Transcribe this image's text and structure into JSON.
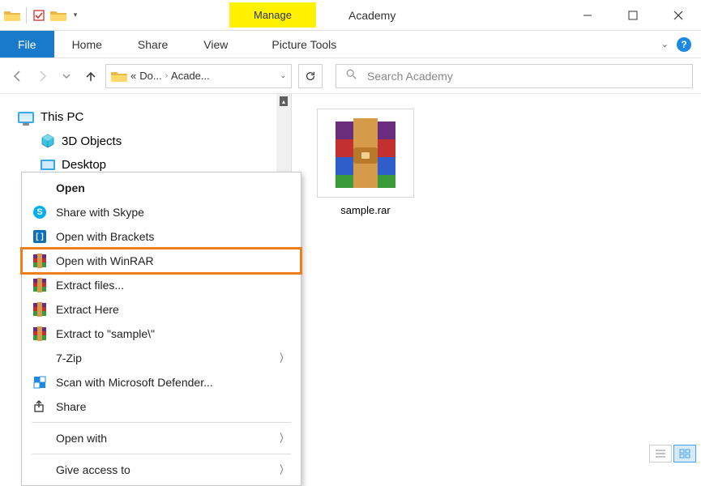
{
  "window": {
    "title": "Academy",
    "contextual_tab": "Manage",
    "contextual_group": "Picture Tools"
  },
  "ribbon": {
    "file": "File",
    "tabs": [
      "Home",
      "Share",
      "View"
    ]
  },
  "breadcrumb": {
    "prefix": "«",
    "seg1": "Do...",
    "seg2": "Acade..."
  },
  "search": {
    "placeholder": "Search Academy"
  },
  "tree": {
    "root": "This PC",
    "items": [
      "3D Objects",
      "Desktop"
    ]
  },
  "file": {
    "name": "sample.rar"
  },
  "ctx": {
    "items": [
      {
        "label": "Open",
        "bold": true,
        "icon": "",
        "sub": false
      },
      {
        "label": "Share with Skype",
        "icon": "skype",
        "sub": false
      },
      {
        "label": "Open with Brackets",
        "icon": "brackets",
        "sub": false
      },
      {
        "label": "Open with WinRAR",
        "icon": "rar",
        "sub": false,
        "highlight": true
      },
      {
        "label": "Extract files...",
        "icon": "rar",
        "sub": false
      },
      {
        "label": "Extract Here",
        "icon": "rar",
        "sub": false
      },
      {
        "label": "Extract to \"sample\\\"",
        "icon": "rar",
        "sub": false
      },
      {
        "label": "7-Zip",
        "icon": "",
        "sub": true
      },
      {
        "label": "Scan with Microsoft Defender...",
        "icon": "defender",
        "sub": false
      },
      {
        "label": "Share",
        "icon": "share",
        "sub": false
      },
      {
        "label": "Open with",
        "icon": "",
        "sub": true,
        "sep_before": true
      },
      {
        "label": "Give access to",
        "icon": "",
        "sub": true,
        "sep_before": true
      }
    ]
  }
}
